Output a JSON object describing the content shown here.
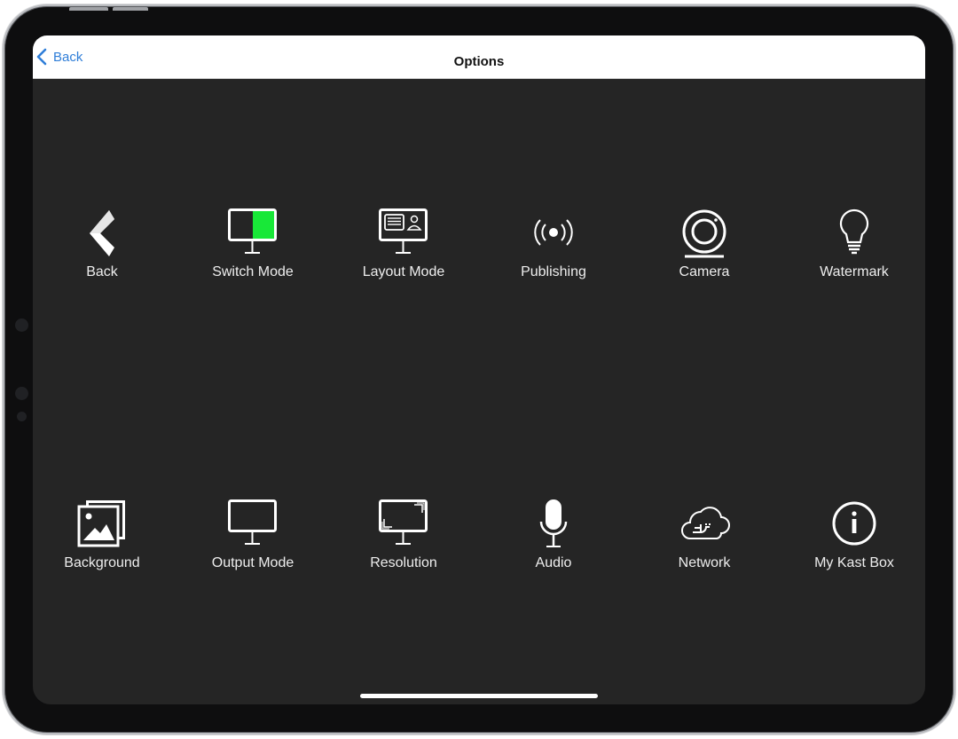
{
  "navbar": {
    "back_label": "Back",
    "title": "Options"
  },
  "tiles": [
    {
      "label": "Back",
      "icon": "back-chevron-icon"
    },
    {
      "label": "Switch Mode",
      "icon": "switch-mode-monitor-icon"
    },
    {
      "label": "Layout Mode",
      "icon": "layout-mode-monitor-icon"
    },
    {
      "label": "Publishing",
      "icon": "broadcast-icon"
    },
    {
      "label": "Camera",
      "icon": "camera-icon"
    },
    {
      "label": "Watermark",
      "icon": "lightbulb-icon"
    },
    {
      "label": "Background",
      "icon": "image-stack-icon"
    },
    {
      "label": "Output Mode",
      "icon": "monitor-icon"
    },
    {
      "label": "Resolution",
      "icon": "resolution-monitor-icon"
    },
    {
      "label": "Audio",
      "icon": "microphone-icon"
    },
    {
      "label": "Network",
      "icon": "cloud-plug-icon"
    },
    {
      "label": "My Kast Box",
      "icon": "info-icon"
    }
  ],
  "colors": {
    "screen_background": "#252525",
    "navbar_background": "#ffffff",
    "link_blue": "#2f7ed8",
    "switch_mode_accent": "#18e838",
    "icon_white": "#ffffff"
  }
}
